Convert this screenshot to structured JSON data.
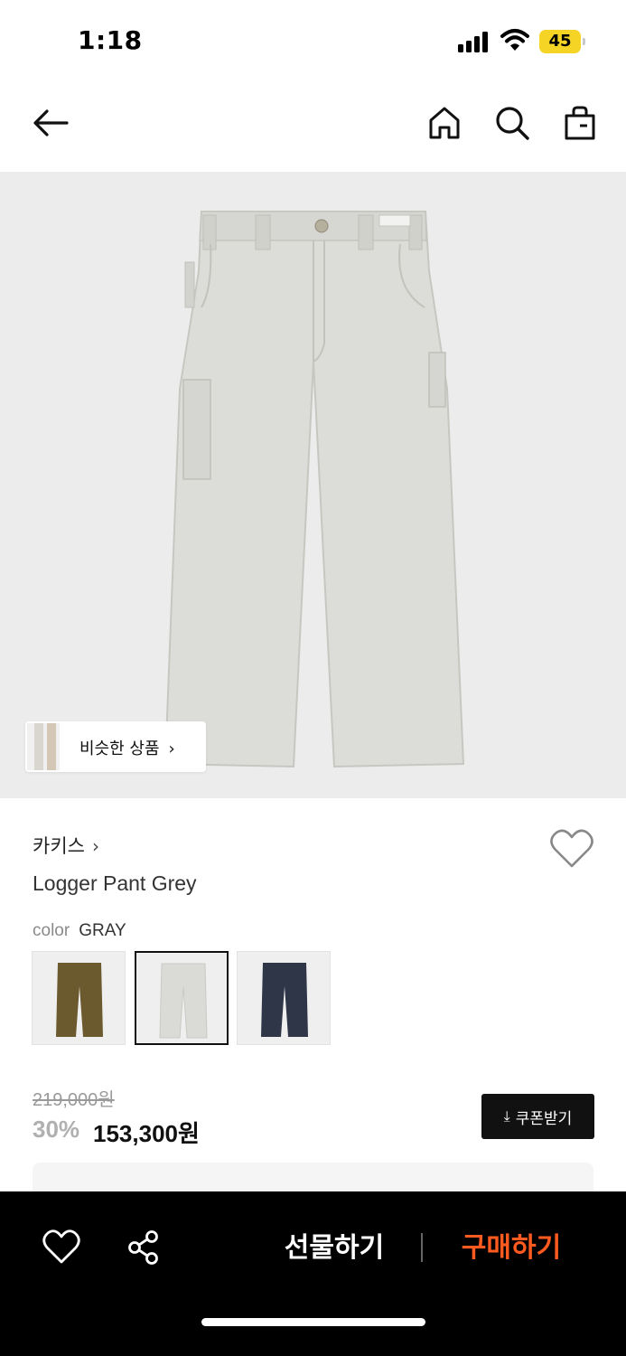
{
  "status_bar": {
    "time": "1:18",
    "battery": "45"
  },
  "product": {
    "brand": "카키스",
    "name": "Logger Pant Grey",
    "color_label": "color",
    "color_value": "GRAY",
    "similar_label": "비슷한 상품",
    "swatches": [
      {
        "name": "brown",
        "color": "#6b5a2e"
      },
      {
        "name": "gray",
        "color": "#dadbd7"
      },
      {
        "name": "navy",
        "color": "#2f3648"
      }
    ]
  },
  "price": {
    "original": "219,000원",
    "discount": "30%",
    "sale": "153,300원",
    "coupon_label": "쿠폰받기"
  },
  "bottom_bar": {
    "gift_label": "선물하기",
    "buy_label": "구매하기"
  },
  "icons": [
    "back-arrow-icon",
    "home-icon",
    "search-icon",
    "shopping-bag-icon",
    "heart-icon",
    "share-icon",
    "download-icon"
  ],
  "colors": {
    "accent": "#ff5a1f",
    "dark": "#111111",
    "hero_bg": "#ececec"
  }
}
